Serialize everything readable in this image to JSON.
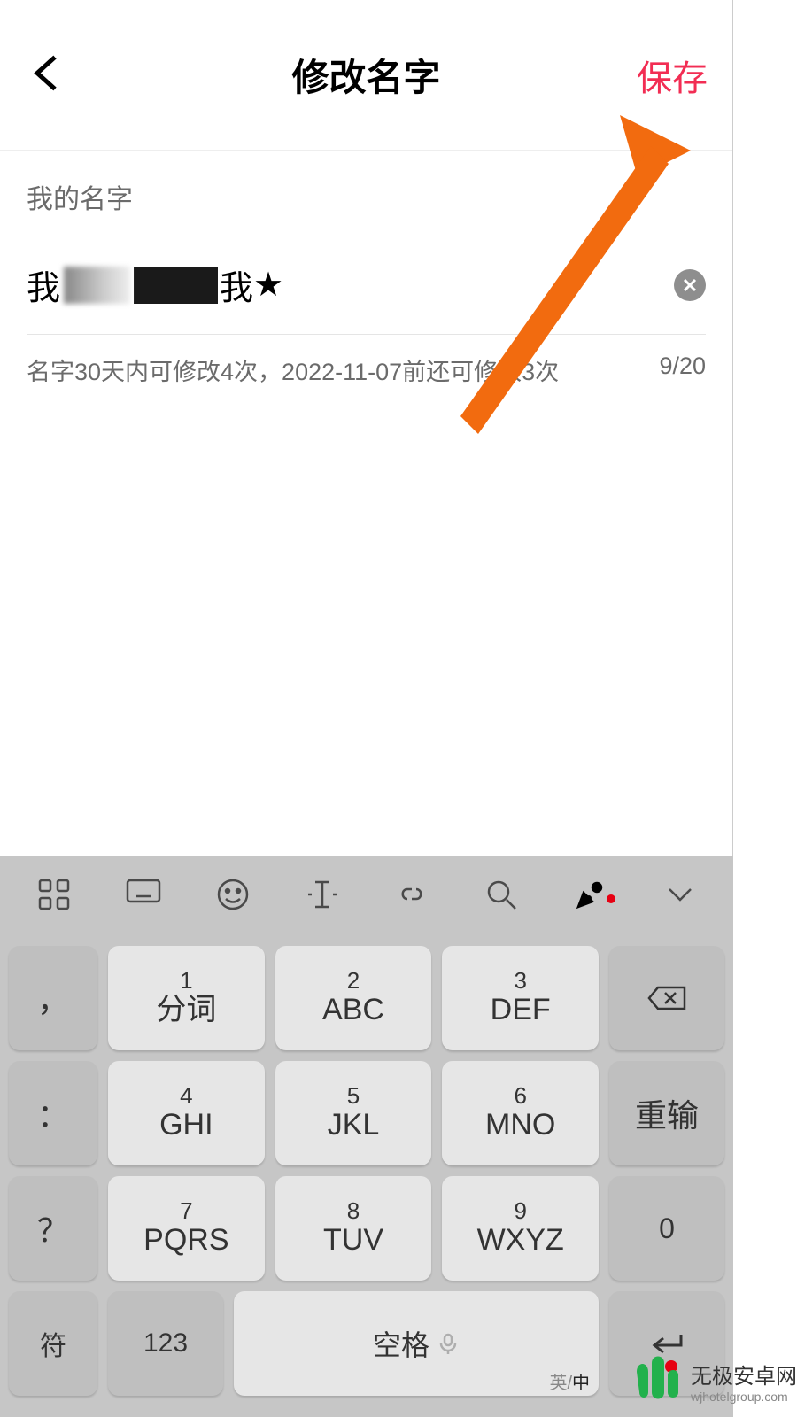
{
  "header": {
    "title": "修改名字",
    "save": "保存"
  },
  "content": {
    "label": "我的名字",
    "name_prefix": "我",
    "name_mid": "我",
    "star": "★",
    "hint": "名字30天内可修改4次，2022-11-07前还可修改3次",
    "counter": "9/20"
  },
  "keyboard": {
    "row1": {
      "punct": "，",
      "k1n": "1",
      "k1s": "分词",
      "k2n": "2",
      "k2s": "ABC",
      "k3n": "3",
      "k3s": "DEF"
    },
    "row2": {
      "punct": "：",
      "k1n": "4",
      "k1s": "GHI",
      "k2n": "5",
      "k2s": "JKL",
      "k3n": "6",
      "k3s": "MNO",
      "right": "重输"
    },
    "row3": {
      "punct": "？",
      "k1n": "7",
      "k1s": "PQRS",
      "k2n": "8",
      "k2s": "TUV",
      "k3n": "9",
      "k3s": "WXYZ",
      "right": "0"
    },
    "row4": {
      "sym": "符",
      "num": "123",
      "space": "空格",
      "lang_en": "英",
      "lang_zh": "中"
    }
  },
  "watermark": {
    "line1": "无极安卓网",
    "line2": "wjhotelgroup.com"
  }
}
